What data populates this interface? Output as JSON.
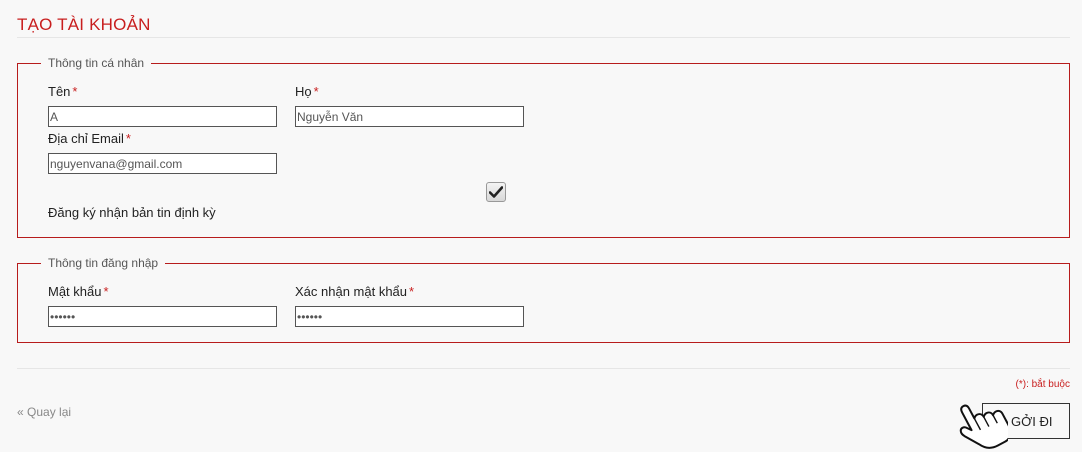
{
  "page": {
    "title": "TẠO TÀI KHOẢN"
  },
  "personal": {
    "legend": "Thông tin cá nhân",
    "first_name": {
      "label": "Tên",
      "value": "A"
    },
    "last_name": {
      "label": "Họ",
      "value": "Nguyễn Văn"
    },
    "email": {
      "label": "Địa chỉ Email",
      "value": "nguyenvana@gmail.com"
    },
    "newsletter": {
      "label": "Đăng ký nhận bản tin định kỳ",
      "checked": true
    }
  },
  "login": {
    "legend": "Thông tin đăng nhập",
    "password": {
      "label": "Mật khẩu",
      "value": "••••••"
    },
    "confirm_password": {
      "label": "Xác nhận mật khẩu",
      "value": "••••••"
    }
  },
  "required_mark": "*",
  "required_note": "(*): bắt buộc",
  "back_link": "« Quay lại",
  "submit_label": "GỞI ĐI",
  "colors": {
    "accent": "#c81e1e",
    "border": "#b71c1c",
    "background": "#f8f8f8"
  },
  "icons": {
    "checkmark": "checkmark-icon",
    "cursor": "hand-pointer-icon"
  }
}
